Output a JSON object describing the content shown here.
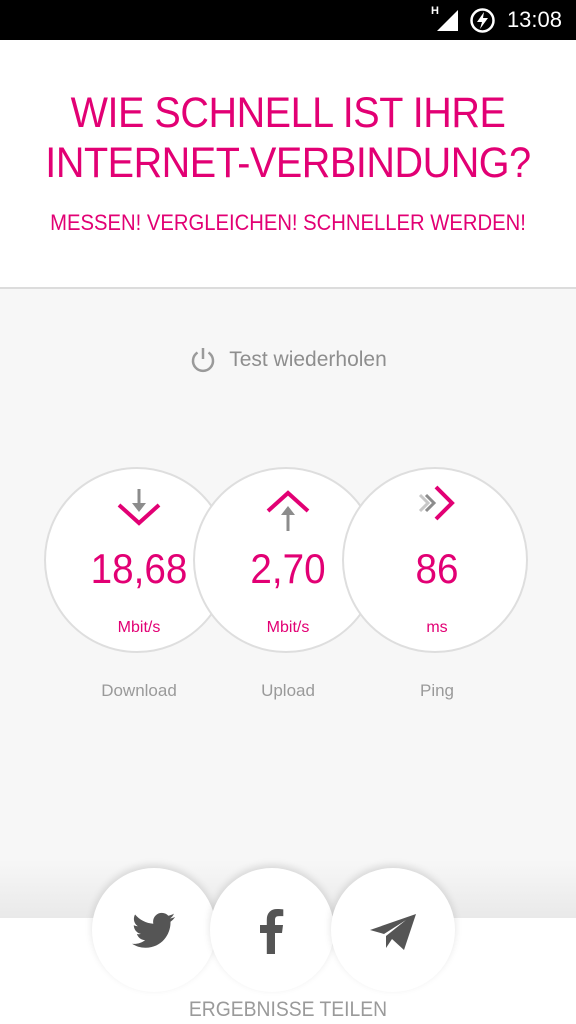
{
  "status_bar": {
    "network": "H",
    "time": "13:08"
  },
  "header": {
    "title_line1": "WIE SCHNELL IST IHRE",
    "title_line2": "INTERNET-VERBINDUNG?",
    "subtitle": "MESSEN! VERGLEICHEN! SCHNELLER WERDEN!"
  },
  "retest": {
    "label": "Test wiederholen",
    "icon": "power-icon"
  },
  "results": [
    {
      "value": "18,68",
      "unit": "Mbit/s",
      "caption": "Download",
      "icon": "download-icon"
    },
    {
      "value": "2,70",
      "unit": "Mbit/s",
      "caption": "Upload",
      "icon": "upload-icon"
    },
    {
      "value": "86",
      "unit": "ms",
      "caption": "Ping",
      "icon": "ping-icon"
    }
  ],
  "share": {
    "label": "ERGEBNISSE TEILEN",
    "buttons": [
      "twitter-icon",
      "facebook-icon",
      "send-icon"
    ]
  },
  "colors": {
    "accent": "#e20074",
    "muted": "#9a9a9a",
    "panel": "#f7f7f7"
  }
}
